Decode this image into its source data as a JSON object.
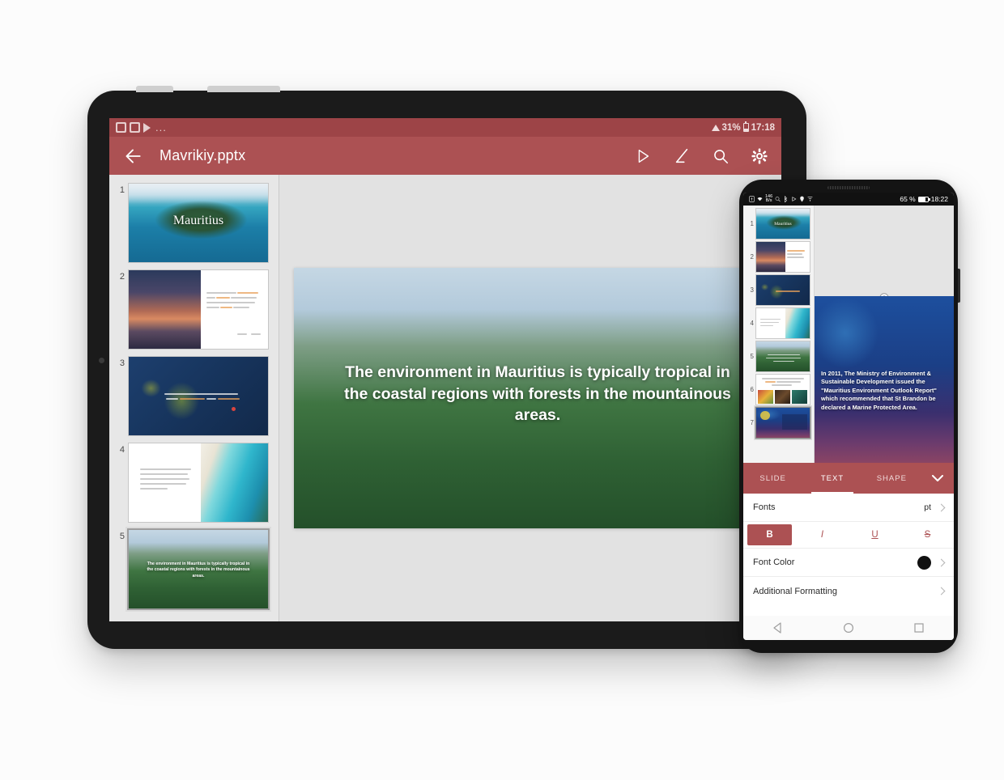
{
  "tablet": {
    "status_bar": {
      "app_icons": [
        "gallery-icon",
        "file-icon",
        "play-store-icon"
      ],
      "ellipsis": "...",
      "wifi": "wifi-icon",
      "battery_percent": "31%",
      "time": "17:18"
    },
    "app_bar": {
      "back": "back-arrow-icon",
      "filename": "Mavrikiy.pptx",
      "actions": [
        "present-icon",
        "edit-pen-icon",
        "search-icon",
        "settings-gear-icon"
      ]
    },
    "slides": [
      {
        "num": "1",
        "art": "art-island",
        "title": "Mauritius",
        "selected": false
      },
      {
        "num": "2",
        "art": "art-sunset",
        "title": "",
        "selected": false
      },
      {
        "num": "3",
        "art": "art-map",
        "title": "The country includes the islands of Rodrigues and Reunion",
        "selected": false
      },
      {
        "num": "4",
        "art": "art-lagoon",
        "title": "",
        "selected": false
      },
      {
        "num": "5",
        "art": "art-forest",
        "title": "The environment in Mauritius is typically tropical in the coastal regions with forests in the mountainous areas.",
        "selected": true
      }
    ],
    "current_slide": {
      "text": "The environment in Mauritius is typically tropical in the coastal regions with forests in the mountainous areas."
    }
  },
  "phone": {
    "status_bar": {
      "icons": [
        "sim-icon",
        "wifi-icon",
        "data-speed-icon",
        "search-icon",
        "bluetooth-icon",
        "play-icon",
        "location-icon",
        "filter-icon"
      ],
      "data_speed": "146",
      "data_speed_unit": "B/s",
      "battery_percent": "65 %",
      "time": "18:22"
    },
    "slides": [
      {
        "num": "1",
        "art": "art-island",
        "selected": false
      },
      {
        "num": "2",
        "art": "art-sunset",
        "selected": false
      },
      {
        "num": "3",
        "art": "art-map",
        "selected": false
      },
      {
        "num": "4",
        "art": "art-lagoon",
        "selected": false
      },
      {
        "num": "5",
        "art": "art-forest",
        "selected": false
      },
      {
        "num": "6",
        "art": "art-white",
        "selected": false
      },
      {
        "num": "7",
        "art": "art-reef",
        "selected": true
      }
    ],
    "current_slide": {
      "text": "In 2011, The Ministry of Environment & Sustainable Development issued the \"Mauritius Environment Outlook Report\" which recommended that St Brandon be declared a Marine Protected Area."
    },
    "format_panel": {
      "tabs": [
        {
          "label": "SLIDE",
          "active": false
        },
        {
          "label": "TEXT",
          "active": true
        },
        {
          "label": "SHAPE",
          "active": false
        }
      ],
      "collapse_icon": "chevron-down-icon",
      "rows": {
        "fonts_label": "Fonts",
        "fonts_unit": "pt",
        "font_color_label": "Font Color",
        "font_color_value": "#111111",
        "additional_label": "Additional Formatting"
      },
      "styles": [
        {
          "label": "B",
          "name": "bold",
          "active": true
        },
        {
          "label": "I",
          "name": "italic",
          "active": false
        },
        {
          "label": "U",
          "name": "underline",
          "active": false
        },
        {
          "label": "S",
          "name": "strikethrough",
          "active": false
        }
      ]
    },
    "nav_bar": [
      "back-triangle-icon",
      "home-circle-icon",
      "recents-square-icon"
    ]
  },
  "colors": {
    "brand": "#ac5153",
    "status_bar": "#9d4447",
    "canvas": "#e2e2e2"
  }
}
